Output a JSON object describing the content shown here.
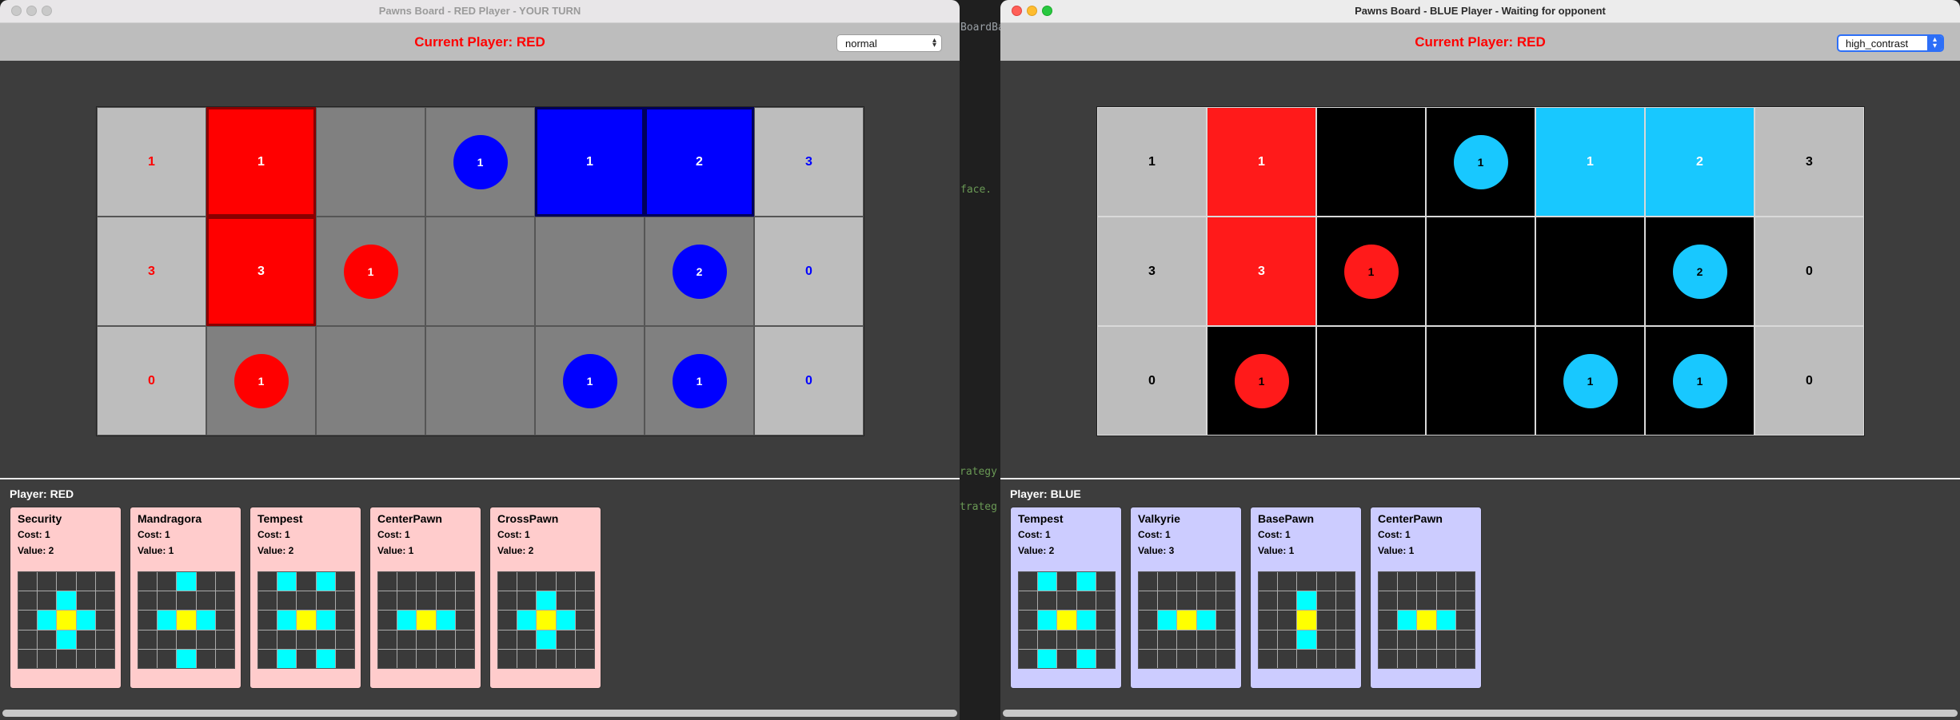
{
  "background_fragments": [
    "BoardBa",
    "face.",
    "rategy",
    "trateg"
  ],
  "windows": [
    {
      "title": "Pawns Board - RED Player - YOUR TURN",
      "current_player_label": "Current Player: RED",
      "mode_select": "normal",
      "colors": {
        "score_red": "#ff0000",
        "score_blue": "#0000ff",
        "red_owned": "#ff0000",
        "blue_owned": "#0000ff",
        "empty": "#808080",
        "score_bg": "#bdbdbd"
      },
      "board": [
        {
          "left_score": "1",
          "right_score": "3",
          "cells": [
            {
              "type": "card",
              "owner": "red",
              "text": "1"
            },
            {
              "type": "empty",
              "text": ""
            },
            {
              "type": "pawn",
              "owner": "blue",
              "text": "1"
            },
            {
              "type": "card",
              "owner": "blue",
              "text": "1"
            },
            {
              "type": "card",
              "owner": "blue",
              "text": "2"
            }
          ]
        },
        {
          "left_score": "3",
          "right_score": "0",
          "cells": [
            {
              "type": "card",
              "owner": "red",
              "text": "3"
            },
            {
              "type": "pawn",
              "owner": "red",
              "text": "1"
            },
            {
              "type": "empty",
              "text": ""
            },
            {
              "type": "empty",
              "text": ""
            },
            {
              "type": "pawn",
              "owner": "blue",
              "text": "2"
            }
          ]
        },
        {
          "left_score": "0",
          "right_score": "0",
          "cells": [
            {
              "type": "pawn",
              "owner": "red",
              "text": "1"
            },
            {
              "type": "empty",
              "text": ""
            },
            {
              "type": "empty",
              "text": ""
            },
            {
              "type": "pawn",
              "owner": "blue",
              "text": "1"
            },
            {
              "type": "pawn",
              "owner": "blue",
              "text": "1"
            }
          ]
        }
      ],
      "hand": {
        "player_label": "Player: RED",
        "card_color": "#ffcccc",
        "cards": [
          {
            "name": "Security",
            "cost": "Cost: 1",
            "value": "Value: 2",
            "influence": [
              [
                0,
                0,
                0,
                0,
                0
              ],
              [
                0,
                0,
                1,
                0,
                0
              ],
              [
                0,
                1,
                2,
                1,
                0
              ],
              [
                0,
                0,
                1,
                0,
                0
              ],
              [
                0,
                0,
                0,
                0,
                0
              ]
            ]
          },
          {
            "name": "Mandragora",
            "cost": "Cost: 1",
            "value": "Value: 1",
            "influence": [
              [
                0,
                0,
                1,
                0,
                0
              ],
              [
                0,
                0,
                0,
                0,
                0
              ],
              [
                0,
                1,
                2,
                1,
                0
              ],
              [
                0,
                0,
                0,
                0,
                0
              ],
              [
                0,
                0,
                1,
                0,
                0
              ]
            ]
          },
          {
            "name": "Tempest",
            "cost": "Cost: 1",
            "value": "Value: 2",
            "influence": [
              [
                0,
                1,
                0,
                1,
                0
              ],
              [
                0,
                0,
                0,
                0,
                0
              ],
              [
                0,
                1,
                2,
                1,
                0
              ],
              [
                0,
                0,
                0,
                0,
                0
              ],
              [
                0,
                1,
                0,
                1,
                0
              ]
            ]
          },
          {
            "name": "CenterPawn",
            "cost": "Cost: 1",
            "value": "Value: 1",
            "influence": [
              [
                0,
                0,
                0,
                0,
                0
              ],
              [
                0,
                0,
                0,
                0,
                0
              ],
              [
                0,
                1,
                2,
                1,
                0
              ],
              [
                0,
                0,
                0,
                0,
                0
              ],
              [
                0,
                0,
                0,
                0,
                0
              ]
            ]
          },
          {
            "name": "CrossPawn",
            "cost": "Cost: 1",
            "value": "Value: 2",
            "influence": [
              [
                0,
                0,
                0,
                0,
                0
              ],
              [
                0,
                0,
                1,
                0,
                0
              ],
              [
                0,
                1,
                2,
                1,
                0
              ],
              [
                0,
                0,
                1,
                0,
                0
              ],
              [
                0,
                0,
                0,
                0,
                0
              ]
            ]
          }
        ]
      }
    },
    {
      "title": "Pawns Board - BLUE Player - Waiting for opponent",
      "current_player_label": "Current Player: RED",
      "mode_select": "high_contrast",
      "colors": {
        "score_red": "#000000",
        "score_blue": "#000000",
        "red_owned": "#ff1a1a",
        "blue_owned": "#18c8ff",
        "empty": "#000000",
        "score_bg": "#bdbdbd"
      },
      "board": [
        {
          "left_score": "1",
          "right_score": "3",
          "cells": [
            {
              "type": "card",
              "owner": "red",
              "text": "1"
            },
            {
              "type": "empty",
              "text": ""
            },
            {
              "type": "pawn",
              "owner": "blue",
              "text": "1"
            },
            {
              "type": "card",
              "owner": "blue",
              "text": "1"
            },
            {
              "type": "card",
              "owner": "blue",
              "text": "2"
            }
          ]
        },
        {
          "left_score": "3",
          "right_score": "0",
          "cells": [
            {
              "type": "card",
              "owner": "red",
              "text": "3"
            },
            {
              "type": "pawn",
              "owner": "red",
              "text": "1"
            },
            {
              "type": "empty",
              "text": ""
            },
            {
              "type": "empty",
              "text": ""
            },
            {
              "type": "pawn",
              "owner": "blue",
              "text": "2"
            }
          ]
        },
        {
          "left_score": "0",
          "right_score": "0",
          "cells": [
            {
              "type": "pawn",
              "owner": "red",
              "text": "1"
            },
            {
              "type": "empty",
              "text": ""
            },
            {
              "type": "empty",
              "text": ""
            },
            {
              "type": "pawn",
              "owner": "blue",
              "text": "1"
            },
            {
              "type": "pawn",
              "owner": "blue",
              "text": "1"
            }
          ]
        }
      ],
      "hand": {
        "player_label": "Player: BLUE",
        "card_color": "#ccccff",
        "cards": [
          {
            "name": "Tempest",
            "cost": "Cost: 1",
            "value": "Value: 2",
            "influence": [
              [
                0,
                1,
                0,
                1,
                0
              ],
              [
                0,
                0,
                0,
                0,
                0
              ],
              [
                0,
                1,
                2,
                1,
                0
              ],
              [
                0,
                0,
                0,
                0,
                0
              ],
              [
                0,
                1,
                0,
                1,
                0
              ]
            ]
          },
          {
            "name": "Valkyrie",
            "cost": "Cost: 1",
            "value": "Value: 3",
            "influence": [
              [
                0,
                0,
                0,
                0,
                0
              ],
              [
                0,
                0,
                0,
                0,
                0
              ],
              [
                0,
                1,
                2,
                1,
                0
              ],
              [
                0,
                0,
                0,
                0,
                0
              ],
              [
                0,
                0,
                0,
                0,
                0
              ]
            ]
          },
          {
            "name": "BasePawn",
            "cost": "Cost: 1",
            "value": "Value: 1",
            "influence": [
              [
                0,
                0,
                0,
                0,
                0
              ],
              [
                0,
                0,
                1,
                0,
                0
              ],
              [
                0,
                0,
                2,
                0,
                0
              ],
              [
                0,
                0,
                1,
                0,
                0
              ],
              [
                0,
                0,
                0,
                0,
                0
              ]
            ]
          },
          {
            "name": "CenterPawn",
            "cost": "Cost: 1",
            "value": "Value: 1",
            "influence": [
              [
                0,
                0,
                0,
                0,
                0
              ],
              [
                0,
                0,
                0,
                0,
                0
              ],
              [
                0,
                1,
                2,
                1,
                0
              ],
              [
                0,
                0,
                0,
                0,
                0
              ],
              [
                0,
                0,
                0,
                0,
                0
              ]
            ]
          }
        ]
      }
    }
  ]
}
